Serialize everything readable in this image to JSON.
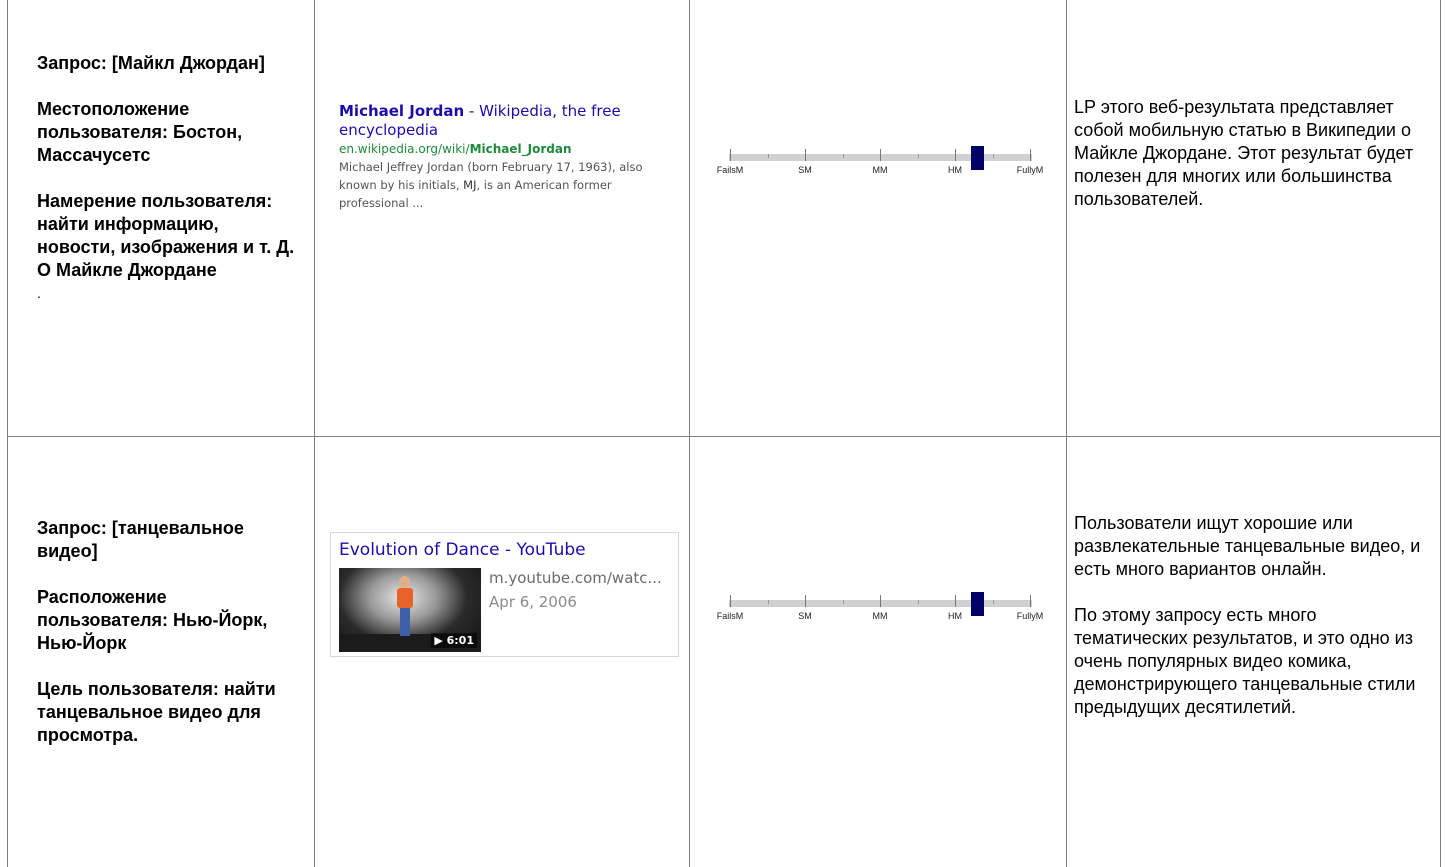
{
  "rows": [
    {
      "query": {
        "paragraphs": [
          "Запрос: [Майкл Джордан]",
          "Местоположение пользователя: Бостон, Массачусетс",
          "Намерение пользователя: найти информацию, новости, изображения и т. Д. О Майкле Джордане"
        ],
        "trailing": "."
      },
      "result": {
        "title_bold": "Michael Jordan",
        "title_rest": " - Wikipedia, the free encyclopedia",
        "url_plain": "en.wikipedia.org/wiki/",
        "url_bold": "Michael_Jordan",
        "snippet_a": "Michael Jeffrey Jordan (born February 17, 1963), also known by his initials, ",
        "snippet_bold": "MJ",
        "snippet_b": ", is an American former professional ..."
      },
      "rating": {
        "labels": [
          "FailsM",
          "SM",
          "MM",
          "HM",
          "FullyM"
        ],
        "value": 0.8
      },
      "comment": [
        "LP этого веб-результата представляет собой мобильную статью в Википедии о Майкле Джордане. Этот результат будет полезен для многих или большинства пользователей."
      ]
    },
    {
      "query": {
        "paragraphs": [
          "Запрос: [танцевальное видео]",
          "Расположение пользователя: Нью-Йорк, Нью-Йорк",
          "Цель пользователя: найти танцевальное видео для просмотра."
        ]
      },
      "result": {
        "title": "Evolution of Dance - YouTube",
        "url": "m.youtube.com/watc...",
        "date": "Apr 6, 2006",
        "duration": "▶ 6:01",
        "thumb_icon": "video-thumbnail"
      },
      "rating": {
        "labels": [
          "FailsM",
          "SM",
          "MM",
          "HM",
          "FullyM"
        ],
        "value": 0.8
      },
      "comment": [
        "Пользователи ищут хорошие или развлекательные танцевальные видео, и есть много вариантов онлайн.",
        "По этому запросу есть много тематических результатов, и это одно из очень популярных видео комика, демонстрирующего танцевальные стили предыдущих десятилетий."
      ]
    }
  ]
}
